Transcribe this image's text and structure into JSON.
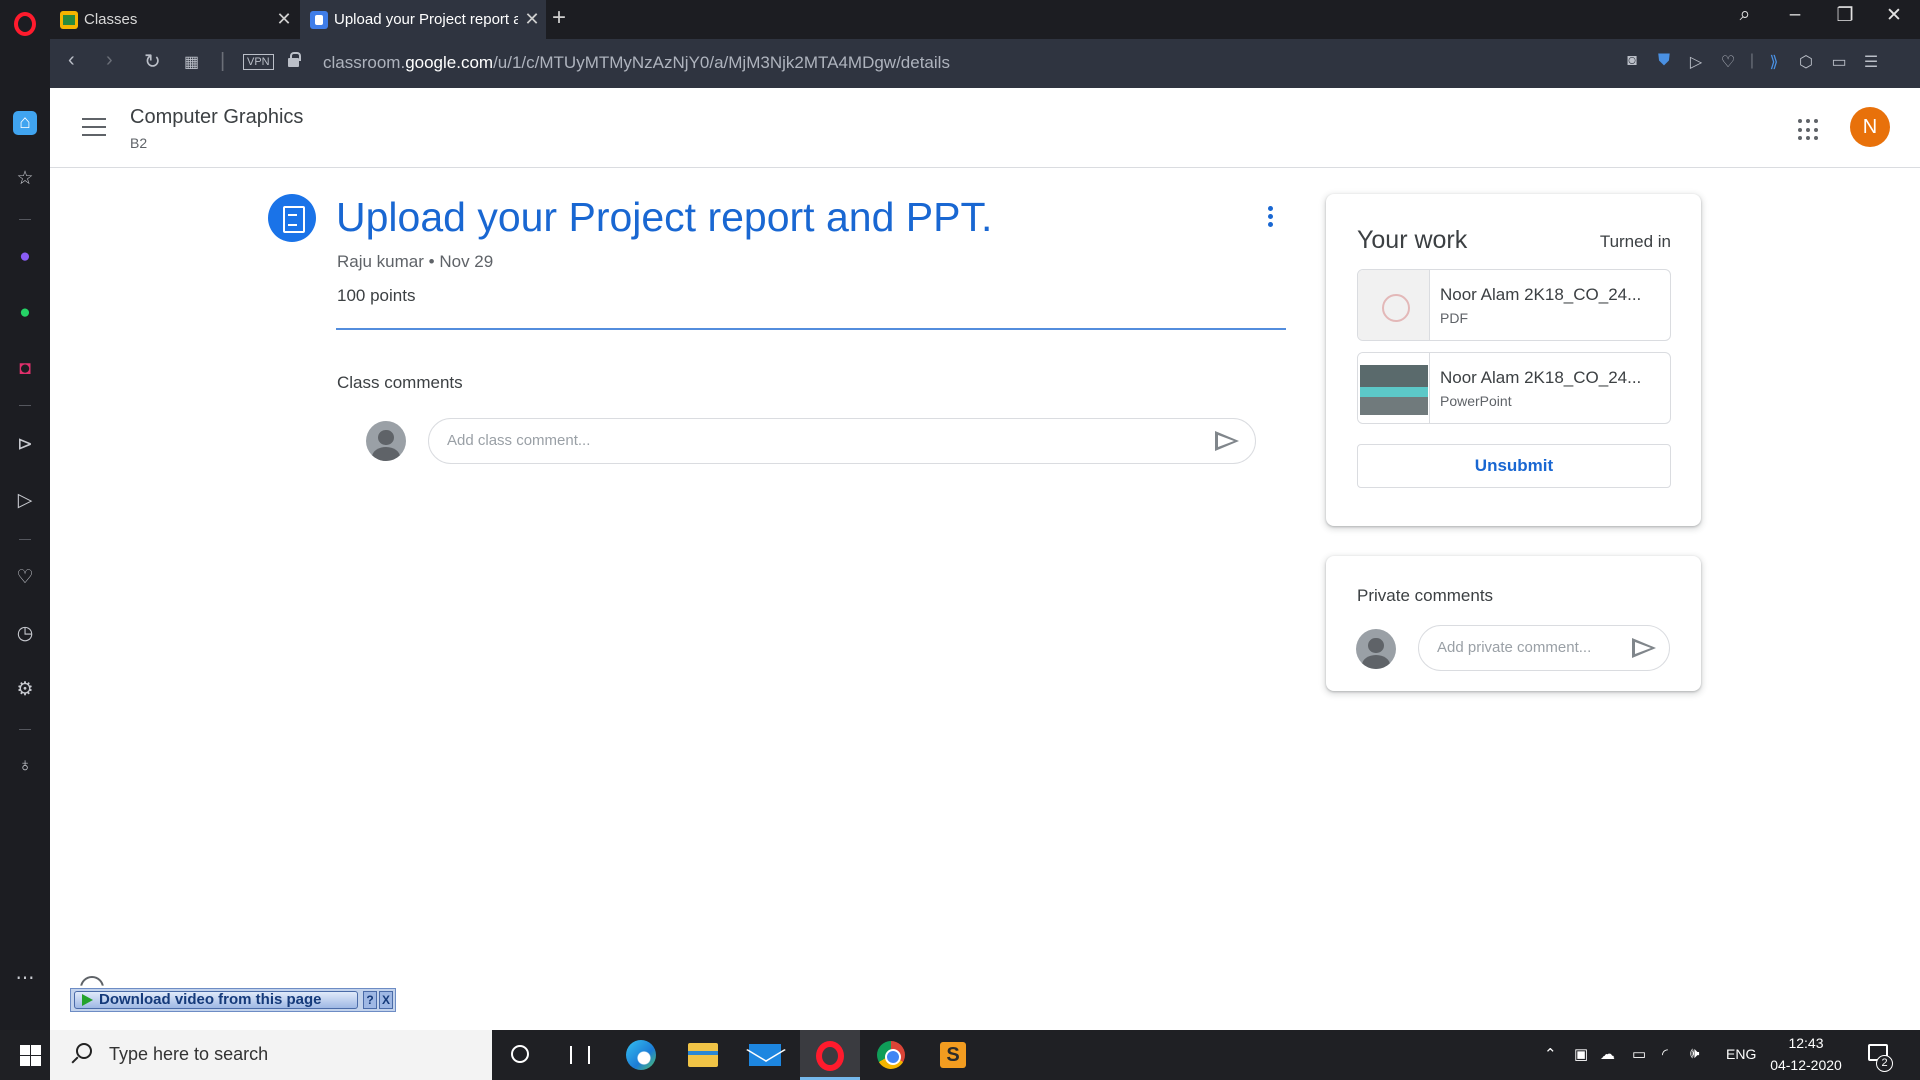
{
  "browser": {
    "tabs": [
      {
        "title": "Classes",
        "close": "✕"
      },
      {
        "title": "Upload your Project report and PPT.",
        "close": "✕"
      }
    ],
    "new_tab": "+",
    "vpn_label": "VPN",
    "url": {
      "prefix": "classroom.",
      "host": "google.com",
      "path": "/u/1/c/MTUyMTMyNzAzNjY0/a/MjM3Njk2MTA4MDgw/details"
    }
  },
  "header": {
    "course_title": "Computer Graphics",
    "course_section": "B2",
    "account_initial": "N"
  },
  "assignment": {
    "title": "Upload your Project report and PPT.",
    "author": "Raju kumar",
    "separator": "•",
    "date": "Nov 29",
    "points": "100 points",
    "class_comments_label": "Class comments",
    "class_comment_placeholder": "Add class comment..."
  },
  "your_work": {
    "title": "Your work",
    "status": "Turned in",
    "attachments": [
      {
        "name": "Noor Alam 2K18_CO_24...",
        "type": "PDF"
      },
      {
        "name": "Noor Alam 2K18_CO_24...",
        "type": "PowerPoint"
      }
    ],
    "unsubmit_label": "Unsubmit"
  },
  "private_comments": {
    "title": "Private comments",
    "placeholder": "Add private comment..."
  },
  "video_helper": {
    "label": "Download video from this page",
    "help": "?",
    "close": "X"
  },
  "taskbar": {
    "search_placeholder": "Type here to search",
    "language": "ENG",
    "time": "12:43",
    "date": "04-12-2020",
    "notification_count": "2"
  }
}
